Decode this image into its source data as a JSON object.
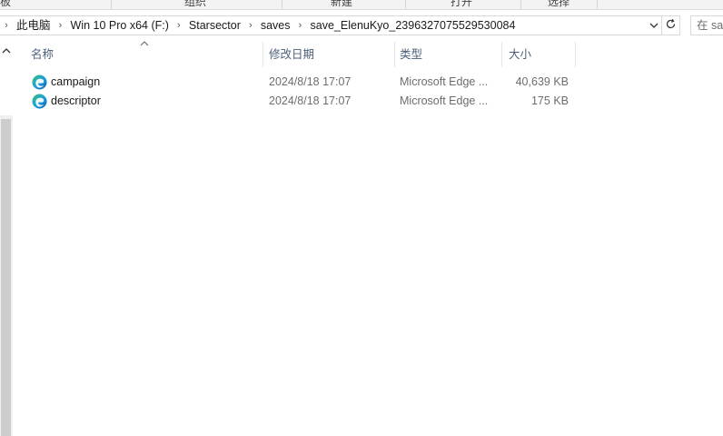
{
  "ribbon": {
    "groups": [
      "板",
      "组织",
      "新建",
      "打开",
      "选择"
    ]
  },
  "address_bar": {
    "crumbs": [
      "此电脑",
      "Win 10 Pro x64 (F:)",
      "Starsector",
      "saves",
      "save_ElenuKyo_2396327075529530084"
    ]
  },
  "search": {
    "placeholder": "在 sa"
  },
  "columns": {
    "name": "名称",
    "date_modified": "修改日期",
    "type": "类型",
    "size": "大小"
  },
  "files": [
    {
      "name": "campaign",
      "date_modified": "2024/8/18 17:07",
      "type": "Microsoft Edge ...",
      "size": "40,639 KB",
      "icon": "edge-icon"
    },
    {
      "name": "descriptor",
      "date_modified": "2024/8/18 17:07",
      "type": "Microsoft Edge ...",
      "size": "175 KB",
      "icon": "edge-icon"
    }
  ],
  "colors": {
    "header_text": "#4c607a",
    "secondary_text": "#6d6d6d",
    "edge_blue": "#1b7fd8",
    "edge_green": "#38c172"
  }
}
